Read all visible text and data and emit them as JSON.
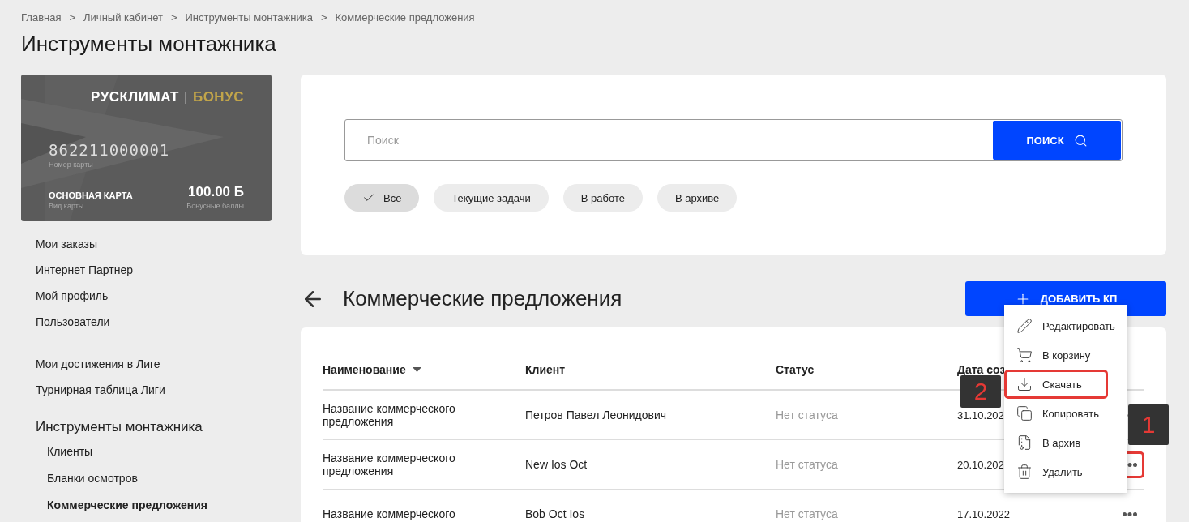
{
  "breadcrumbs": [
    "Главная",
    "Личный кабинет",
    "Инструменты монтажника",
    "Коммерческие предложения"
  ],
  "breadcrumb_separator": ">",
  "page_title": "Инструменты монтажника",
  "bonus_card": {
    "brand": "РУСКЛИМАТ",
    "brand_separator": "|",
    "brand_suffix": "БОНУС",
    "number": "862211000001",
    "number_label": "Номер карты",
    "type": "ОСНОВНАЯ КАРТА",
    "type_label": "Вид карты",
    "balance": "100.00 Б",
    "balance_label": "Бонусные баллы"
  },
  "nav_groups": [
    {
      "items": [
        "Мои заказы",
        "Интернет Партнер",
        "Мой профиль",
        "Пользователи"
      ]
    },
    {
      "items": [
        "Мои достижения в Лиге",
        "Турнирная таблица Лиги"
      ]
    }
  ],
  "nav_section": {
    "title": "Инструменты монтажника",
    "children": [
      {
        "label": "Клиенты",
        "selected": false
      },
      {
        "label": "Бланки осмотров",
        "selected": false
      },
      {
        "label": "Коммерческие предложения",
        "selected": true
      }
    ]
  },
  "search": {
    "placeholder": "Поиск",
    "button": "ПОИСК"
  },
  "filters": [
    {
      "label": "Все",
      "selected": true
    },
    {
      "label": "Текущие задачи",
      "selected": false
    },
    {
      "label": "В работе",
      "selected": false
    },
    {
      "label": "В архиве",
      "selected": false
    }
  ],
  "section_title": "Коммерческие предложения",
  "add_button": "ДОБАВИТЬ КП",
  "table": {
    "columns": [
      "Наименование",
      "Клиент",
      "Статус",
      "Дата соз"
    ],
    "rows": [
      {
        "name": "Название коммерческого предложения",
        "client": "Петров Павел Леонидович",
        "status": "Нет статуса",
        "date": "31.10.202",
        "highlighted": false
      },
      {
        "name": "Название коммерческого предложения",
        "client": "New Ios Oct",
        "status": "Нет статуса",
        "date": "20.10.202",
        "highlighted": true
      },
      {
        "name": "Название коммерческого",
        "client": "Bob Oct Ios",
        "status": "Нет статуса",
        "date": "17.10.2022",
        "highlighted": false
      }
    ]
  },
  "context_menu": [
    {
      "label": "Редактировать",
      "highlighted": false
    },
    {
      "label": "В корзину",
      "highlighted": false
    },
    {
      "label": "Скачать",
      "highlighted": true
    },
    {
      "label": "Копировать",
      "highlighted": false
    },
    {
      "label": "В архив",
      "highlighted": false
    },
    {
      "label": "Удалить",
      "highlighted": false
    }
  ],
  "annotations": [
    "1",
    "2"
  ]
}
